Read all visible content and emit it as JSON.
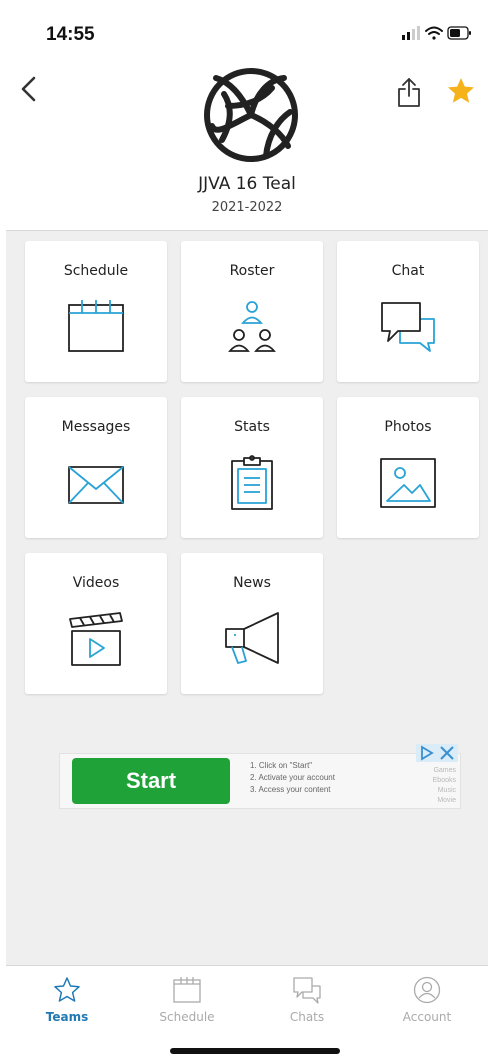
{
  "status_bar": {
    "time": "14:55"
  },
  "header": {
    "team_name": "JJVA 16 Teal",
    "season": "2021-2022",
    "icons": {
      "back": "chevron-left-icon",
      "share": "share-icon",
      "favorite": "star-icon",
      "logo": "volleyball-icon"
    }
  },
  "tiles": [
    {
      "label": "Schedule",
      "icon": "calendar-icon"
    },
    {
      "label": "Roster",
      "icon": "people-icon"
    },
    {
      "label": "Chat",
      "icon": "chat-bubbles-icon"
    },
    {
      "label": "Messages",
      "icon": "envelope-icon"
    },
    {
      "label": "Stats",
      "icon": "clipboard-icon"
    },
    {
      "label": "Photos",
      "icon": "photo-icon"
    },
    {
      "label": "Videos",
      "icon": "clapperboard-icon"
    },
    {
      "label": "News",
      "icon": "megaphone-icon"
    }
  ],
  "ad": {
    "button_label": "Start",
    "steps": [
      "1. Click on \"Start\"",
      "2. Activate your account",
      "3. Access your content"
    ],
    "categories": [
      "Games",
      "Ebooks",
      "Music",
      "Movie"
    ]
  },
  "tabbar": {
    "items": [
      {
        "label": "Teams",
        "icon": "star-outline-icon",
        "active": true
      },
      {
        "label": "Schedule",
        "icon": "calendar-icon",
        "active": false
      },
      {
        "label": "Chats",
        "icon": "chat-icon",
        "active": false
      },
      {
        "label": "Account",
        "icon": "user-circle-icon",
        "active": false
      }
    ]
  },
  "colors": {
    "accent": "#2079b5",
    "icon_blue": "#29a3d6",
    "star": "#f5b21b",
    "ad_green": "#1fa339",
    "background": "#efefef"
  }
}
